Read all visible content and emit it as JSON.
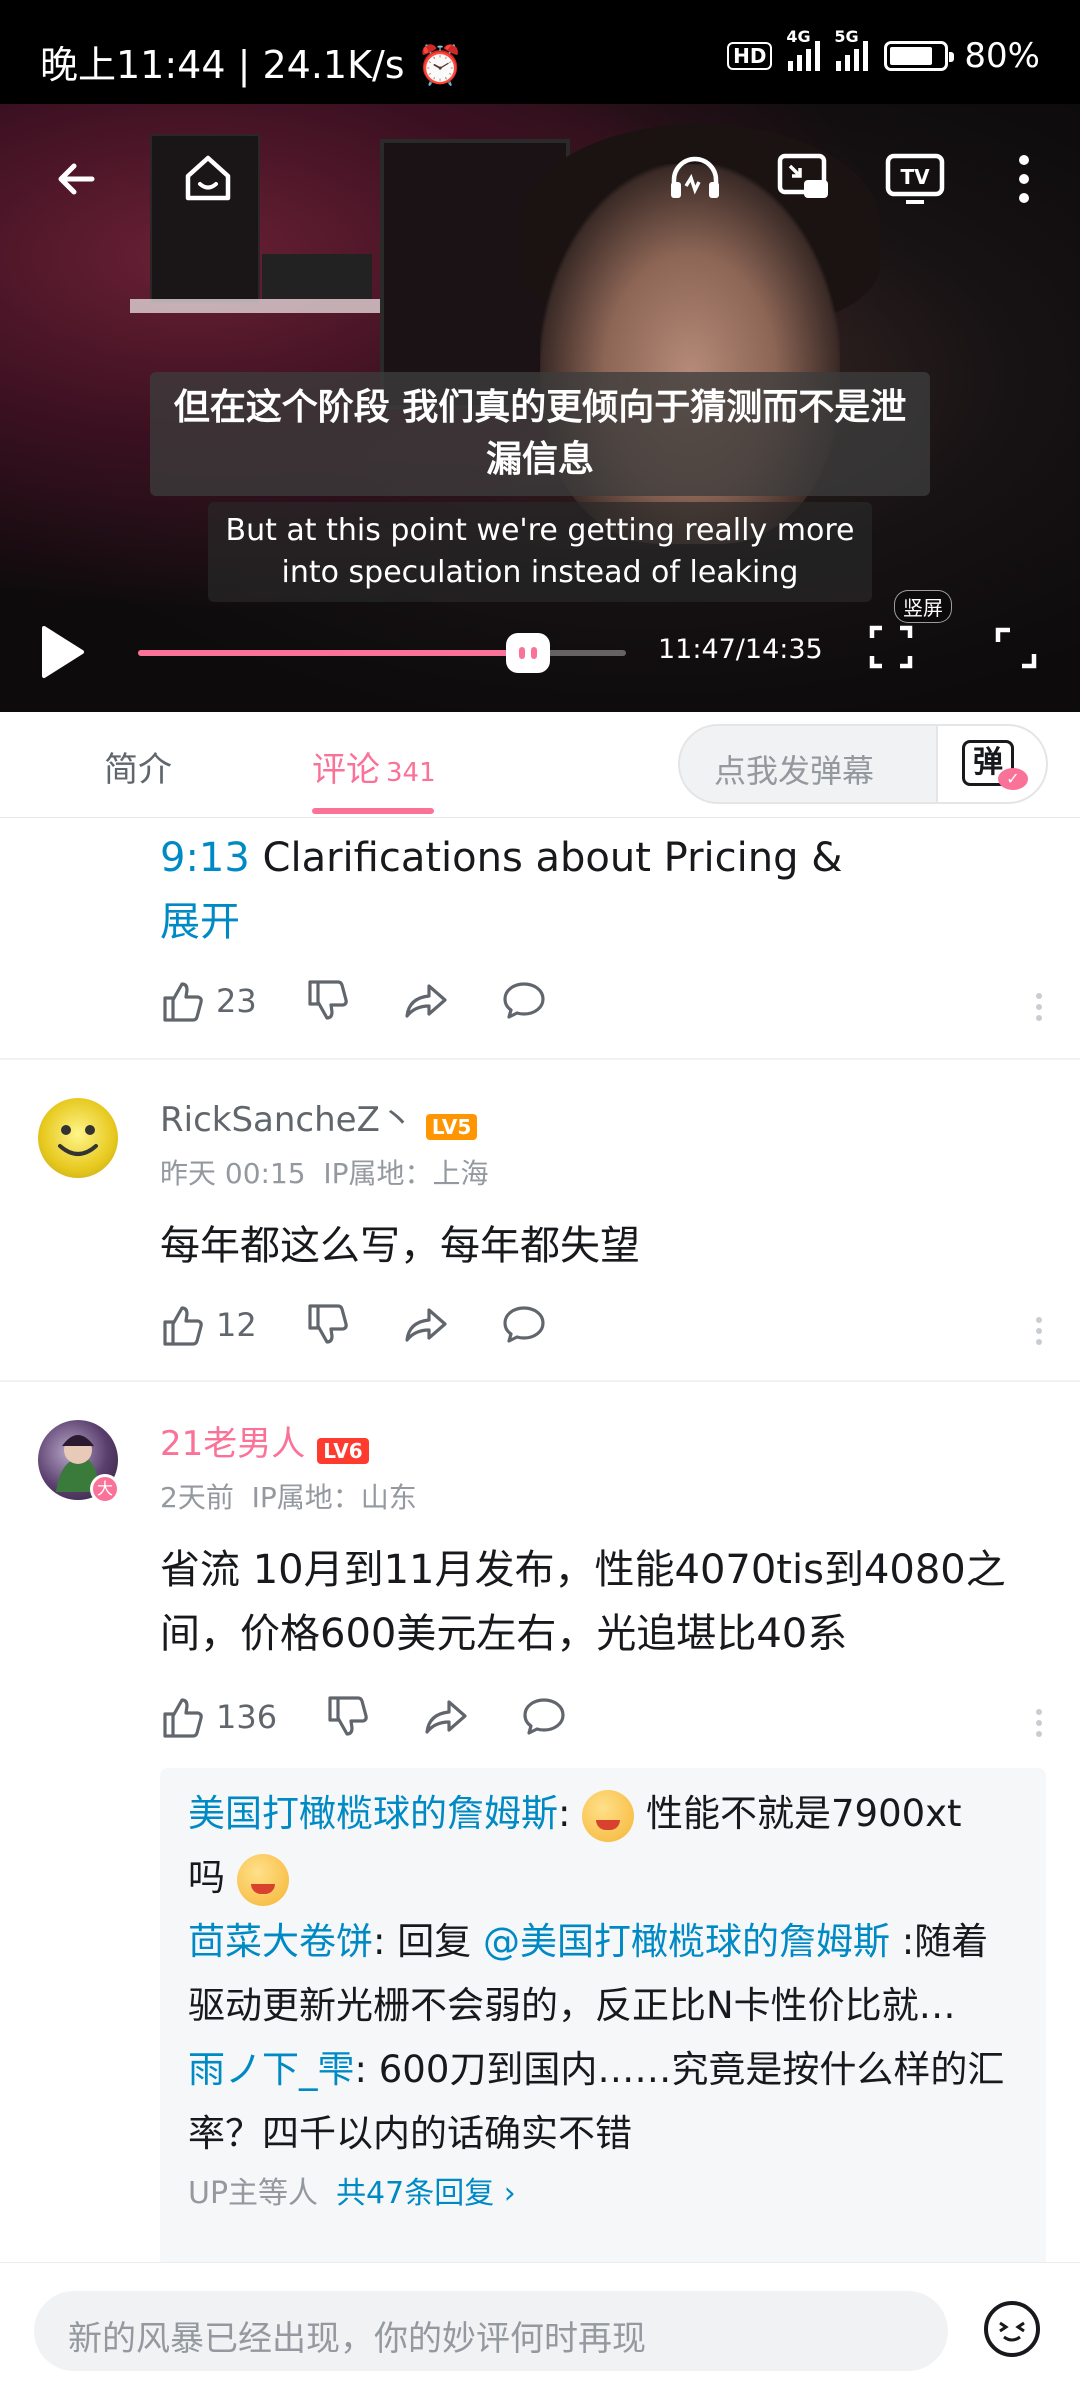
{
  "status_bar": {
    "time": "晚上11:44 | 24.1K/s",
    "network_speed_icon": "alarm-icon",
    "hd": "HD",
    "net1": "4G",
    "net2": "5G",
    "battery": "80%",
    "battery_level": 0.8
  },
  "video": {
    "subtitle_cn": "但在这个阶段 我们真的更倾向于猜测而不是泄漏信息",
    "subtitle_en": "But at this point we're getting really more into speculation instead of leaking",
    "time": "11:47/14:35",
    "progress_fraction": 0.8,
    "vertical_label": "竖屏"
  },
  "tabs": {
    "intro": "简介",
    "comments": "评论",
    "comments_count": "341",
    "danmu_placeholder": "点我发弹幕",
    "danmu_glyph": "弹"
  },
  "comment0": {
    "timestamp": "9:13",
    "text": " Clarifications about Pricing &",
    "expand": "展开",
    "likes": "23"
  },
  "comment1": {
    "user": "RickSancheZ丶",
    "level": "LV5",
    "time": "昨天 00:15",
    "ip": "IP属地：上海",
    "text": "每年都这么写，每年都失望",
    "likes": "12"
  },
  "comment2": {
    "user": "21老男人",
    "level": "LV6",
    "time": "2天前",
    "ip": "IP属地：山东",
    "text": "省流 10月到11月发布，性能4070tis到4080之间，价格600美元左右，光追堪比40系",
    "likes": "136",
    "avatar_badge": "大"
  },
  "replies": [
    {
      "user": "美国打橄榄球的詹姆斯",
      "sep": ": ",
      "text_a": " 性能不就是7900xt",
      "text_b": "吗 "
    },
    {
      "user": "茴菜大卷饼",
      "sep": ": ",
      "prefix": "回复 ",
      "mention": "@美国打橄榄球的詹姆斯",
      "text": " :随着驱动更新光栅不会弱的，反正比N卡性价比就…"
    },
    {
      "user": "雨ノ下_雫",
      "sep": ": ",
      "text": "600刀到国内……究竟是按什么样的汇率？四千以内的话确实不错"
    }
  ],
  "reply_footer": {
    "up": "UP主等人",
    "more": "共47条回复 ›"
  },
  "bottom": {
    "placeholder": "新的风暴已经出现，你的妙评何时再现"
  },
  "colors": {
    "accent": "#fb7299",
    "link": "#008ac5"
  }
}
